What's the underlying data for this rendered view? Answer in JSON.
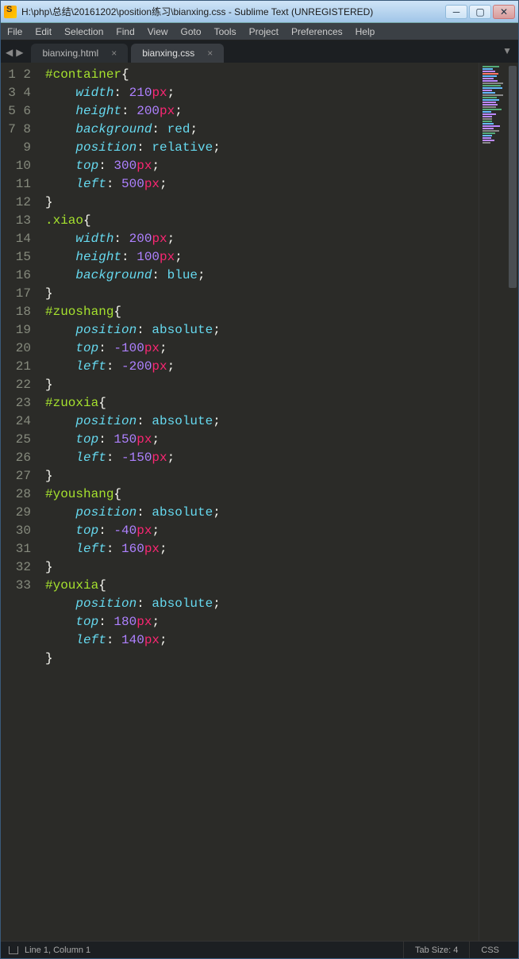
{
  "window": {
    "title": "H:\\php\\总结\\20161202\\position练习\\bianxing.css - Sublime Text (UNREGISTERED)"
  },
  "menu": {
    "items": [
      "File",
      "Edit",
      "Selection",
      "Find",
      "View",
      "Goto",
      "Tools",
      "Project",
      "Preferences",
      "Help"
    ]
  },
  "tabs": {
    "items": [
      {
        "label": "bianxing.html",
        "active": false
      },
      {
        "label": "bianxing.css",
        "active": true
      }
    ]
  },
  "editor": {
    "line_count": 33,
    "code_tokens": [
      [
        [
          "sel",
          "#container"
        ],
        [
          "brace",
          "{"
        ]
      ],
      [
        [
          "indent",
          "    "
        ],
        [
          "prop",
          "width"
        ],
        [
          "punct",
          ": "
        ],
        [
          "num",
          "210"
        ],
        [
          "unit",
          "px"
        ],
        [
          "punct",
          ";"
        ]
      ],
      [
        [
          "indent",
          "    "
        ],
        [
          "prop",
          "height"
        ],
        [
          "punct",
          ": "
        ],
        [
          "num",
          "200"
        ],
        [
          "unit",
          "px"
        ],
        [
          "punct",
          ";"
        ]
      ],
      [
        [
          "indent",
          "    "
        ],
        [
          "prop",
          "background"
        ],
        [
          "punct",
          ": "
        ],
        [
          "val",
          "red"
        ],
        [
          "punct",
          ";"
        ]
      ],
      [
        [
          "indent",
          "    "
        ],
        [
          "prop",
          "position"
        ],
        [
          "punct",
          ": "
        ],
        [
          "val",
          "relative"
        ],
        [
          "punct",
          ";"
        ]
      ],
      [
        [
          "indent",
          "    "
        ],
        [
          "prop",
          "top"
        ],
        [
          "punct",
          ": "
        ],
        [
          "num",
          "300"
        ],
        [
          "unit",
          "px"
        ],
        [
          "punct",
          ";"
        ]
      ],
      [
        [
          "indent",
          "    "
        ],
        [
          "prop",
          "left"
        ],
        [
          "punct",
          ": "
        ],
        [
          "num",
          "500"
        ],
        [
          "unit",
          "px"
        ],
        [
          "punct",
          ";"
        ]
      ],
      [
        [
          "brace",
          "}"
        ]
      ],
      [
        [
          "cls",
          ".xiao"
        ],
        [
          "brace",
          "{"
        ]
      ],
      [
        [
          "indent",
          "    "
        ],
        [
          "prop",
          "width"
        ],
        [
          "punct",
          ": "
        ],
        [
          "num",
          "200"
        ],
        [
          "unit",
          "px"
        ],
        [
          "punct",
          ";"
        ]
      ],
      [
        [
          "indent",
          "    "
        ],
        [
          "prop",
          "height"
        ],
        [
          "punct",
          ": "
        ],
        [
          "num",
          "100"
        ],
        [
          "unit",
          "px"
        ],
        [
          "punct",
          ";"
        ]
      ],
      [
        [
          "indent",
          "    "
        ],
        [
          "prop",
          "background"
        ],
        [
          "punct",
          ": "
        ],
        [
          "val",
          "blue"
        ],
        [
          "punct",
          ";"
        ]
      ],
      [
        [
          "brace",
          "}"
        ]
      ],
      [
        [
          "sel",
          "#zuoshang"
        ],
        [
          "brace",
          "{"
        ]
      ],
      [
        [
          "indent",
          "    "
        ],
        [
          "prop",
          "position"
        ],
        [
          "punct",
          ": "
        ],
        [
          "val",
          "absolute"
        ],
        [
          "punct",
          ";"
        ]
      ],
      [
        [
          "indent",
          "    "
        ],
        [
          "prop",
          "top"
        ],
        [
          "punct",
          ": "
        ],
        [
          "num",
          "-100"
        ],
        [
          "unit",
          "px"
        ],
        [
          "punct",
          ";"
        ]
      ],
      [
        [
          "indent",
          "    "
        ],
        [
          "prop",
          "left"
        ],
        [
          "punct",
          ": "
        ],
        [
          "num",
          "-200"
        ],
        [
          "unit",
          "px"
        ],
        [
          "punct",
          ";"
        ]
      ],
      [
        [
          "brace",
          "}"
        ]
      ],
      [
        [
          "sel",
          "#zuoxia"
        ],
        [
          "brace",
          "{"
        ]
      ],
      [
        [
          "indent",
          "    "
        ],
        [
          "prop",
          "position"
        ],
        [
          "punct",
          ": "
        ],
        [
          "val",
          "absolute"
        ],
        [
          "punct",
          ";"
        ]
      ],
      [
        [
          "indent",
          "    "
        ],
        [
          "prop",
          "top"
        ],
        [
          "punct",
          ": "
        ],
        [
          "num",
          "150"
        ],
        [
          "unit",
          "px"
        ],
        [
          "punct",
          ";"
        ]
      ],
      [
        [
          "indent",
          "    "
        ],
        [
          "prop",
          "left"
        ],
        [
          "punct",
          ": "
        ],
        [
          "num",
          "-150"
        ],
        [
          "unit",
          "px"
        ],
        [
          "punct",
          ";"
        ]
      ],
      [
        [
          "brace",
          "}"
        ]
      ],
      [
        [
          "sel",
          "#youshang"
        ],
        [
          "brace",
          "{"
        ]
      ],
      [
        [
          "indent",
          "    "
        ],
        [
          "prop",
          "position"
        ],
        [
          "punct",
          ": "
        ],
        [
          "val",
          "absolute"
        ],
        [
          "punct",
          ";"
        ]
      ],
      [
        [
          "indent",
          "    "
        ],
        [
          "prop",
          "top"
        ],
        [
          "punct",
          ": "
        ],
        [
          "num",
          "-40"
        ],
        [
          "unit",
          "px"
        ],
        [
          "punct",
          ";"
        ]
      ],
      [
        [
          "indent",
          "    "
        ],
        [
          "prop",
          "left"
        ],
        [
          "punct",
          ": "
        ],
        [
          "num",
          "160"
        ],
        [
          "unit",
          "px"
        ],
        [
          "punct",
          ";"
        ]
      ],
      [
        [
          "brace",
          "}"
        ]
      ],
      [
        [
          "sel",
          "#youxia"
        ],
        [
          "brace",
          "{"
        ]
      ],
      [
        [
          "indent",
          "    "
        ],
        [
          "prop",
          "position"
        ],
        [
          "punct",
          ": "
        ],
        [
          "val",
          "absolute"
        ],
        [
          "punct",
          ";"
        ]
      ],
      [
        [
          "indent",
          "    "
        ],
        [
          "prop",
          "top"
        ],
        [
          "punct",
          ": "
        ],
        [
          "num",
          "180"
        ],
        [
          "unit",
          "px"
        ],
        [
          "punct",
          ";"
        ]
      ],
      [
        [
          "indent",
          "    "
        ],
        [
          "prop",
          "left"
        ],
        [
          "punct",
          ": "
        ],
        [
          "num",
          "140"
        ],
        [
          "unit",
          "px"
        ],
        [
          "punct",
          ";"
        ]
      ],
      [
        [
          "brace",
          "}"
        ]
      ]
    ]
  },
  "statusbar": {
    "cursor": "Line 1, Column 1",
    "tab_size": "Tab Size: 4",
    "syntax": "CSS"
  }
}
